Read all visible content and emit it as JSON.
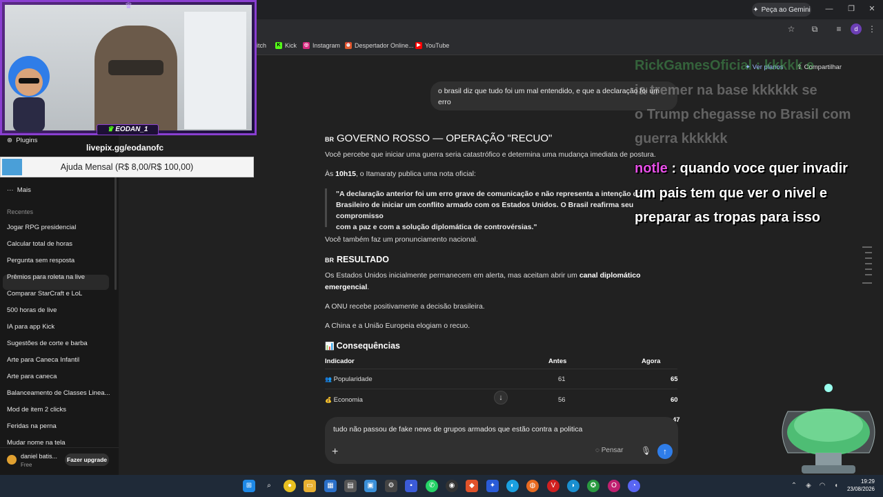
{
  "browser": {
    "gemini_label": "Peça ao Gemini",
    "profile_initial": "d",
    "bookmarks": [
      {
        "label": "itch",
        "color": "#7a47d6"
      },
      {
        "label": "Kick",
        "color": "#53fc18"
      },
      {
        "label": "Instagram",
        "color": "#d6287e"
      },
      {
        "label": "Despertador Online...",
        "color": "#e05a2b"
      },
      {
        "label": "YouTube",
        "color": "#ff0000"
      }
    ]
  },
  "overlay": {
    "streamer_name": "EODAN_1",
    "livepix": "livepix.gg/eodanofc",
    "donation_goal": "Ajuda Mensal (R$ 8,00/R$ 100,00)",
    "donation_progress": 0.08
  },
  "sidebar": {
    "plugins_label": "Plugins",
    "more_label": "Mais",
    "recent_header": "Recentes",
    "recent": [
      "Jogar RPG presidencial",
      "Calcular total de horas",
      "Pergunta sem resposta",
      "Prêmios para roleta na live",
      "Comparar StarCraft e LoL",
      "500 horas de live",
      "IA para app Kick",
      "Sugestões de corte e barba",
      "Arte para Caneca Infantil",
      "Arte para caneca",
      "Balanceamento de Classes Linea...",
      "Mod de item 2 clicks",
      "Feridas na perna",
      "Mudar nome na tela"
    ],
    "user_name": "daniel batis...",
    "user_plan": "Free",
    "upgrade_label": "Fazer upgrade"
  },
  "header": {
    "plans_label": "Ver planos",
    "share_label": "Compartilhar"
  },
  "conversation": {
    "user_message": "o brasil diz que tudo foi um mal entendido, e que a declaração foi um erro",
    "flag": "BR",
    "heading1": "GOVERNO ROSSO — OPERAÇÃO \"RECUO\"",
    "p1": "Você percebe que iniciar uma guerra seria catastrófico e determina uma mudança imediata de postura.",
    "p2_prefix": "Às ",
    "p2_time": "10h15",
    "p2_suffix": ", o Itamaraty publica uma nota oficial:",
    "quote_line1": "\"A declaração anterior foi um erro grave de comunicação e não representa a intenção do",
    "quote_line2": "Brasileiro de iniciar um conflito armado com os Estados Unidos. O Brasil reafirma seu compromisso",
    "quote_line3": "com a paz e com a solução diplomática de controvérsias.\"",
    "p3": "Você também faz um pronunciamento nacional.",
    "heading2": "RESULTADO",
    "p4_prefix": "Os Estados Unidos inicialmente permanecem em alerta, mas aceitam abrir um ",
    "p4_bold": "canal diplomático",
    "p4_bold2": "emergencial",
    "p4_end": ".",
    "p5": "A ONU recebe positivamente a decisão brasileira.",
    "p6": "A China e a União Europeia elogiam o recuo.",
    "heading3": "Consequências",
    "table": {
      "headers": [
        "Indicador",
        "Antes",
        "Agora"
      ],
      "rows": [
        {
          "icon": "👥",
          "label": "Popularidade",
          "before": "61",
          "now": "65"
        },
        {
          "icon": "💰",
          "label": "Economia",
          "before": "56",
          "now": "60"
        }
      ],
      "partial_value": "47"
    }
  },
  "composer": {
    "text": "tudo não passou de fake news de grupos armados que estão contra a politica",
    "think_label": "Pensar"
  },
  "chat_overlay": {
    "faded_name": "RickGamesOficial : kkkkk e",
    "faded_lines": [
      "ia tremer na base kkkkkk se",
      "o Trump chegasse no Brasil com",
      "guerra kkkkkk"
    ],
    "name": "notle",
    "lines": [
      ": quando voce quer invadir",
      "um pais tem que ver o nivel e",
      "preparar as tropas para isso"
    ]
  },
  "taskbar": {
    "time": "19:29",
    "date": "23/08/2026"
  }
}
